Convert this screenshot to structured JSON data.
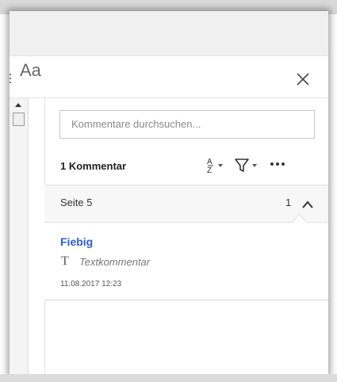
{
  "panel": {
    "font_size_label": "Aa",
    "search_placeholder": "Kommentare durchsuchen...",
    "count_label": "1 Kommentar",
    "icons": {
      "list": "list-icon",
      "close": "close-icon",
      "sort": "sort-az-icon",
      "filter": "filter-icon",
      "more": "more-options-icon",
      "chevron": "chevron-up-icon",
      "text_comment": "text-comment-icon"
    }
  },
  "group": {
    "page_label": "Seite 5",
    "count": "1"
  },
  "comment": {
    "author": "Fiebig",
    "type_icon_glyph": "T",
    "type": "Textkommentar",
    "date": "11.08.2017  12:23"
  },
  "colors": {
    "author_link": "#2a5bd7",
    "panel_bg": "#ffffff",
    "group_bg": "#f7f7f7"
  }
}
